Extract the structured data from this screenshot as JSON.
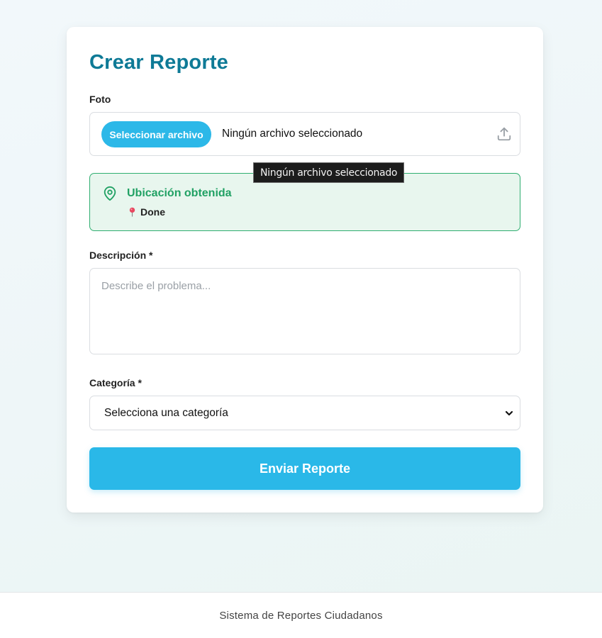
{
  "form": {
    "title": "Crear Reporte",
    "photo_label": "Foto",
    "file_button_label": "Seleccionar archivo",
    "file_status": "Ningún archivo seleccionado",
    "tooltip": "Ningún archivo seleccionado",
    "location": {
      "title": "Ubicación obtenida",
      "status": "Done"
    },
    "description_label": "Descripción *",
    "description_placeholder": "Describe el problema...",
    "category_label": "Categoría *",
    "category_selected": "Selecciona una categoría",
    "submit_label": "Enviar Reporte"
  },
  "footer": {
    "text": "Sistema de Reportes Ciudadanos"
  },
  "colors": {
    "title": "#0e7a96",
    "primary_button": "#2ab8e8",
    "success_border": "#2fae70",
    "success_bg": "#e8f6ee",
    "success_text": "#21a164"
  },
  "icons": {
    "upload": "upload-icon",
    "location": "map-pin-icon",
    "status_pin": "red-pin-icon",
    "select": "chevron-down-icon"
  }
}
